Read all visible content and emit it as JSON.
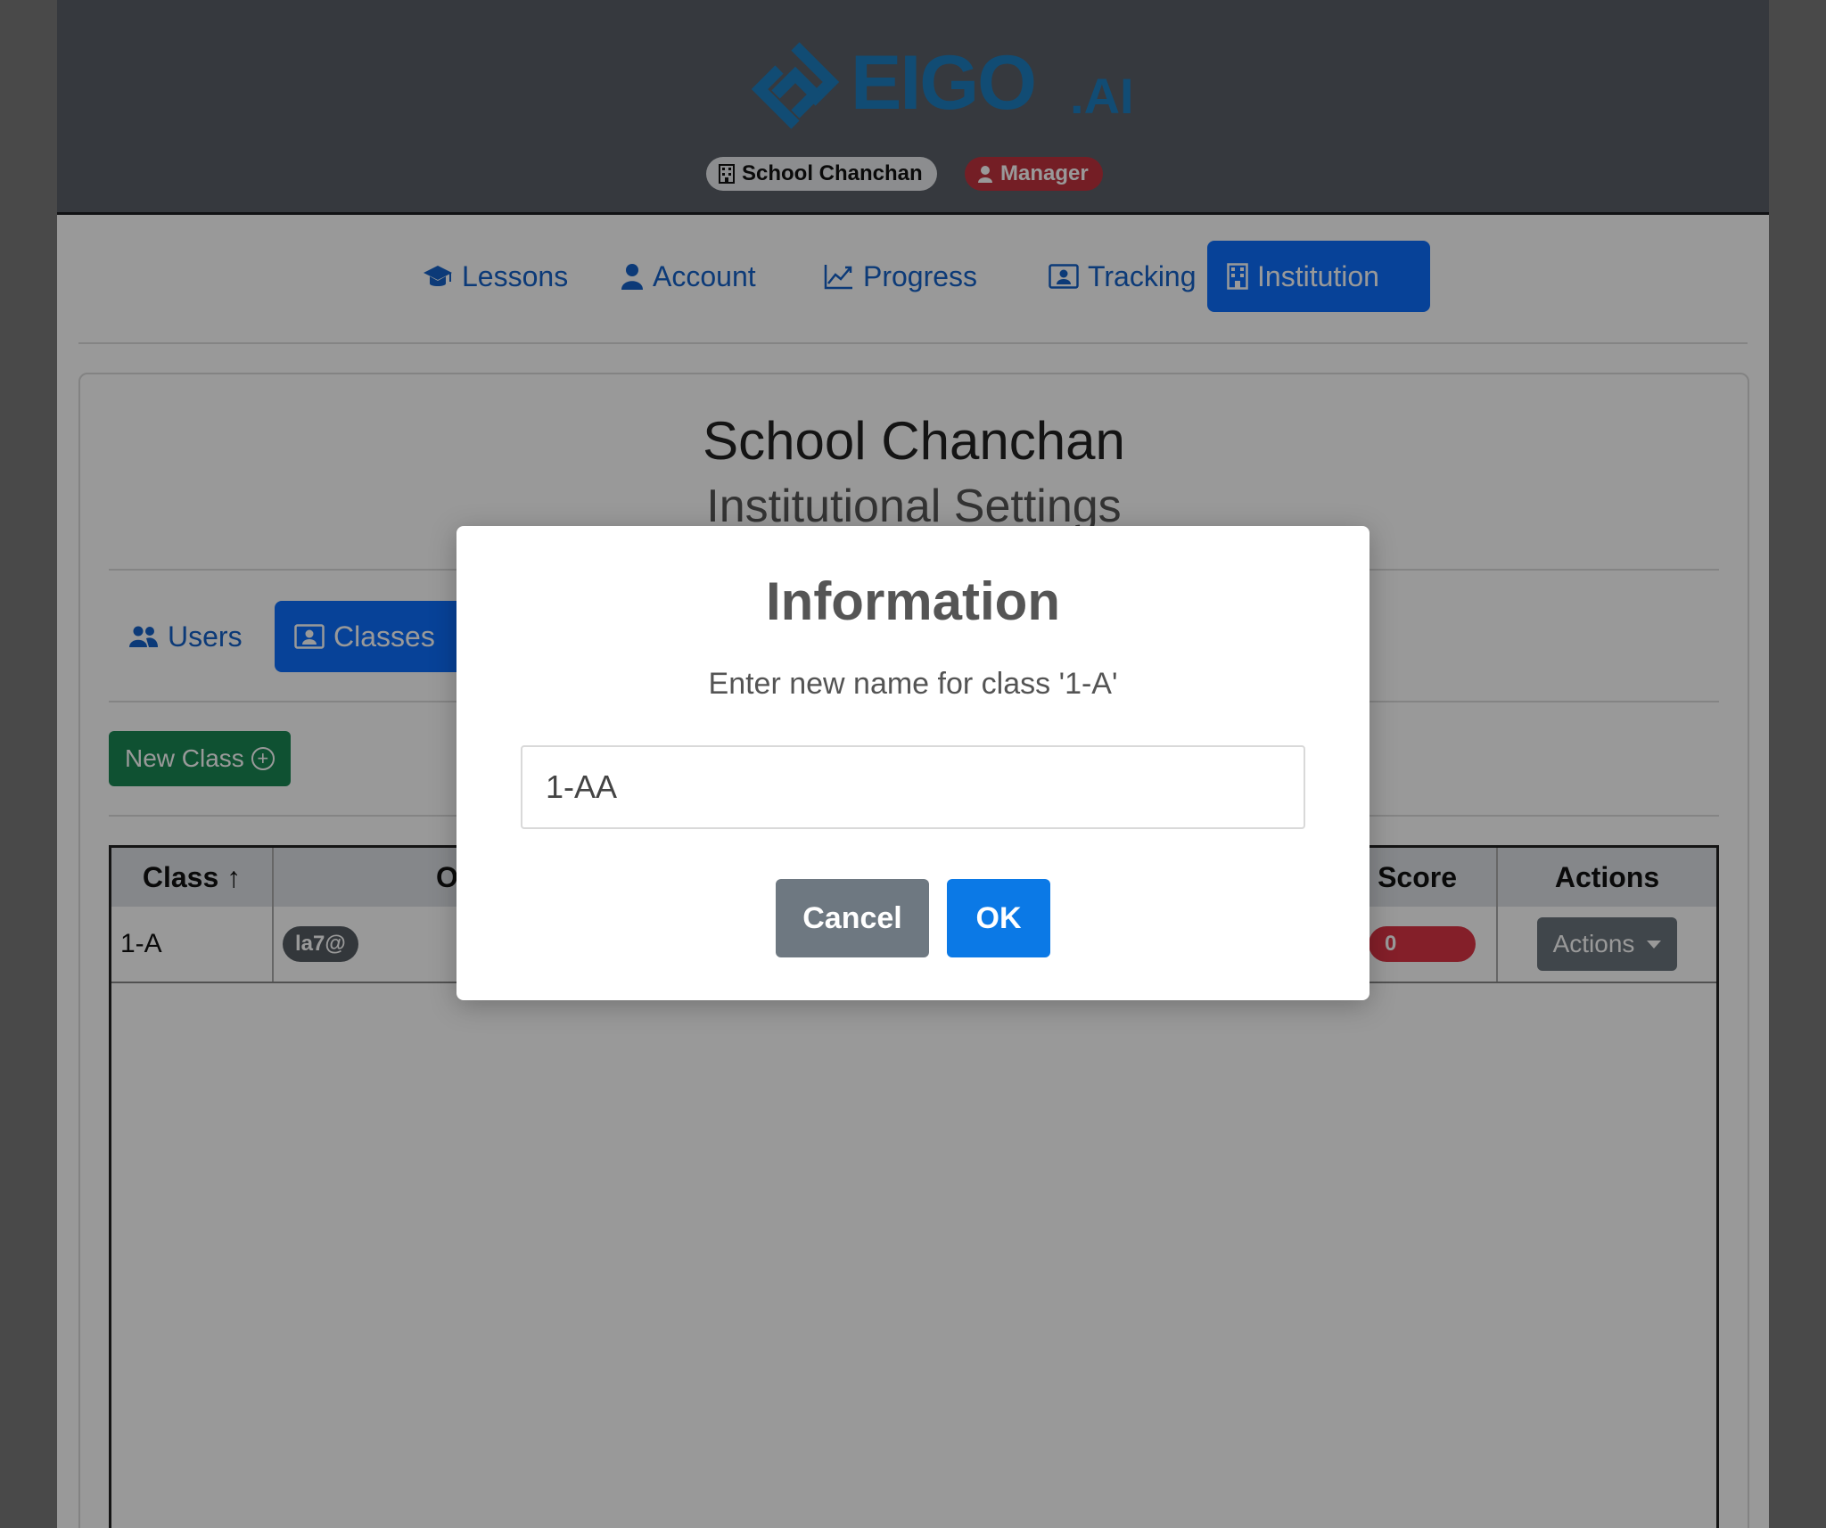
{
  "header": {
    "logo_text": "EIGO",
    "logo_suffix": "AI",
    "school_badge": "School Chanchan",
    "role_badge": "Manager",
    "colors": {
      "header_bg": "#5a6068",
      "logo": "#1d7fc2",
      "role_badge": "#c1333f"
    }
  },
  "nav": {
    "items": [
      {
        "label": "Lessons",
        "icon": "graduation-cap-icon"
      },
      {
        "label": "Account",
        "icon": "user-icon"
      },
      {
        "label": "Progress",
        "icon": "line-chart-icon"
      },
      {
        "label": "Tracking",
        "icon": "person-board-icon"
      },
      {
        "label": "Institution",
        "icon": "building-icon",
        "active": true
      }
    ]
  },
  "institution": {
    "title": "School Chanchan",
    "subtitle": "Institutional Settings",
    "tabs": [
      {
        "label": "Users",
        "icon": "users-icon"
      },
      {
        "label": "Classes",
        "icon": "person-board-icon",
        "active": true
      }
    ],
    "new_class_label": "New Class"
  },
  "table": {
    "columns": [
      "Class ↑",
      "O",
      "Score",
      "Actions"
    ],
    "rows": [
      {
        "class": "1-A",
        "owner": "la7@",
        "score": "0",
        "actions_label": "Actions"
      }
    ]
  },
  "modal": {
    "title": "Information",
    "message": "Enter new name for class '1-A'",
    "input_value": "1-AA",
    "cancel_label": "Cancel",
    "ok_label": "OK",
    "colors": {
      "ok": "#0b79e6",
      "cancel": "#6e7881"
    }
  }
}
